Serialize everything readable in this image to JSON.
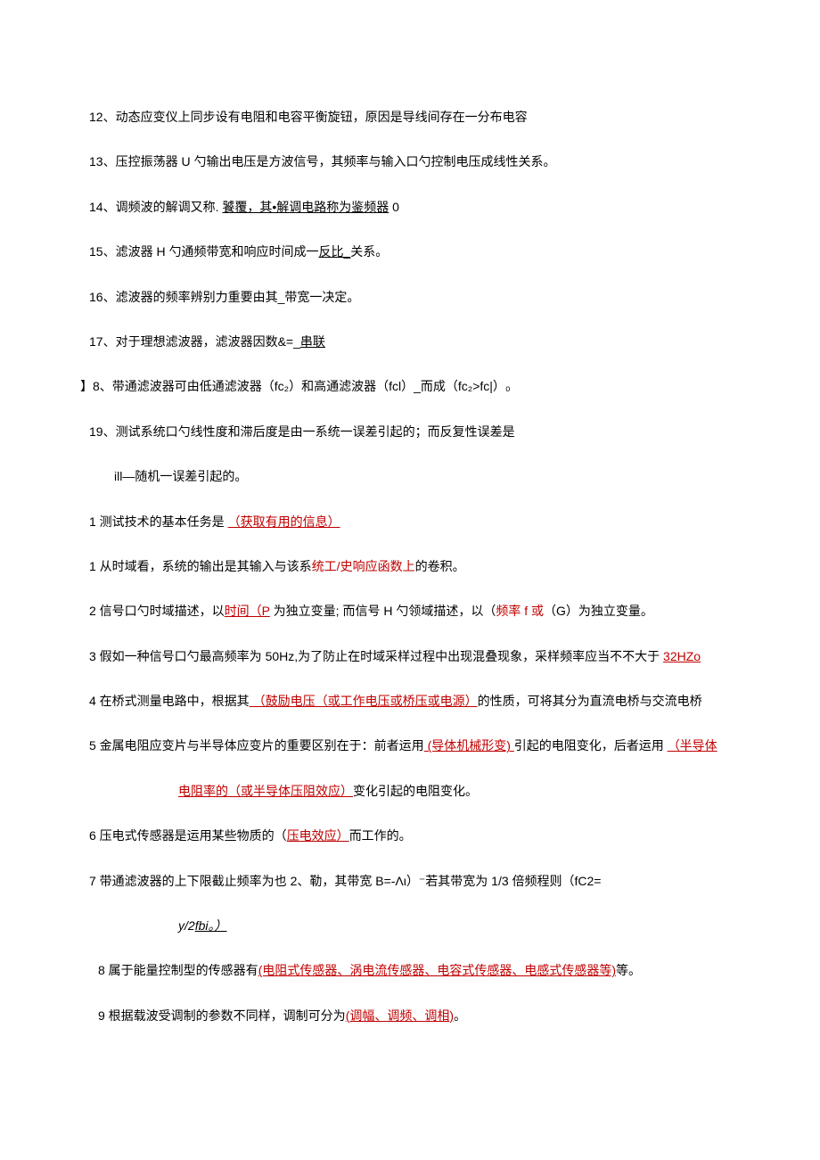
{
  "lines": {
    "l12": {
      "t0": "12、动态应变仪上同步设有电阻和电容平衡旋钮，原因是导线间存在一分布电容"
    },
    "l13": {
      "t0": "13、压控振荡器 U 勺输出电压是方波信号，其频率与输入口勺控制电压成线性关系。"
    },
    "l14": {
      "t0": "14、调频波的解调又称. ",
      "t1": "饕覆，其•解调电路称为鉴频器",
      "t2": " 0"
    },
    "l15": {
      "t0": "15、滤波器 H 勺通频带宽和响应时间成一",
      "t1": "反比_",
      "t2": "关系。"
    },
    "l16": {
      "t0": "16、滤波器的频率辨别力重要由其_带宽一决定。"
    },
    "l17": {
      "t0": "17、对于理想滤波器，滤波器因数&=_",
      "t1": "串联"
    },
    "l18": {
      "t0": "】8、带通滤波器可由低通滤波器（fc₂）和高通滤波器（fcl）_而成（fc₂>fc|）₀"
    },
    "l19a": {
      "t0": "19、测试系统口勺线性度和滞后度是由一系统一误差引起的；而反复性误差是"
    },
    "l19b": {
      "t0": "ill—随机一误差引起的。"
    },
    "q1": {
      "t0": "1 测试技术的基本任务是 ",
      "t1": "（获取有用的信息）"
    },
    "q1b": {
      "t0": "1 从时域看，系统的输出是其输入与该系",
      "t1": "统工/史响应函数上",
      "t2": "的卷积。"
    },
    "q2": {
      "t0": "2 信号口勺时域描述，以",
      "t1": "时间（P",
      "t2": " 为独立变量; 而信号 H 勺领域描述，以（",
      "t3": "频率 f 或",
      "t4": "（G）为独立变量。"
    },
    "q3": {
      "t0": "3 假如一种信号口勺最高频率为 50Hz,为了防止在时域采样过程中出现混叠现象，采样频率应当不不大于 ",
      "t1": "32HZo"
    },
    "q4": {
      "t0": "4 在桥式测量电路中，根据其",
      "t1": " （鼓励电压（或工作电压或桥压或电源）",
      "t2": "的性质，可将其分为直流电桥与交流电桥"
    },
    "q5a": {
      "t0": "5 金属电阻应变片与半导体应变片的重要区别在于：前者运用",
      "t1": " (导体机械形变) ",
      "t2": "引起的电阻变化，后者运用 ",
      "t3": "（半导体"
    },
    "q5b": {
      "t0": "电阻率的（或半导体压阻效应）",
      "t1": "变化引起的电阻变化。"
    },
    "q6": {
      "t0": "6 压电式传感器是运用某些物质的（",
      "t1": "压电效应）",
      "t2": "而工作的。"
    },
    "q7a": {
      "t0": "7 带通滤波器的上下限截止频率为也 2、勒，其带宽 B=-Λι）⁻若其带宽为 1/3 倍频程则（fC2="
    },
    "q7b": {
      "t0": "y/2",
      "t1": "fbi。）"
    },
    "q8": {
      "t0": "8 属于能量控制型的传感器有",
      "t1": "(电阻式传感器、涡电流传感器、电容式传感器、电感式传感器等)",
      "t2": "等。"
    },
    "q9": {
      "t0": "9 根据载波受调制的参数不同样，调制可分为",
      "t1": "(调幅、调频、调相)",
      "t2": "。"
    }
  }
}
